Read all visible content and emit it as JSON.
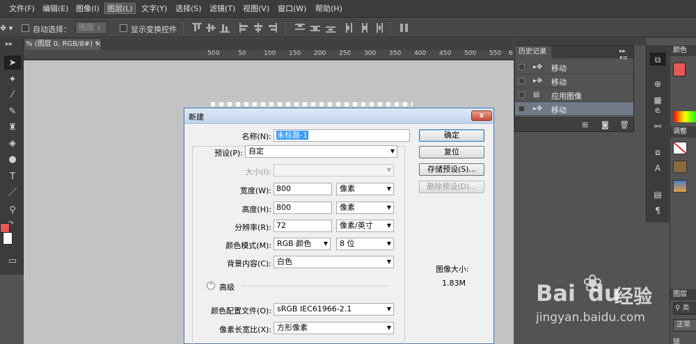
{
  "menubar": {
    "items": [
      "文件(F)",
      "编辑(E)",
      "图像(I)",
      "图层(L)",
      "文字(Y)",
      "选择(S)",
      "滤镜(T)",
      "视图(V)",
      "窗口(W)",
      "帮助(H)"
    ]
  },
  "optbar": {
    "auto_select_label": "自动选择：",
    "auto_select_value": "图层",
    "show_transform_label": "显示变换控件"
  },
  "document": {
    "tab_label": "% (图层 0, RGB/8#) *",
    "close": "×",
    "ruler_labels": [
      "50",
      "0",
      "50",
      "100",
      "150",
      "200",
      "250",
      "300",
      "350",
      "400",
      "450",
      "500",
      "550",
      "6"
    ]
  },
  "history": {
    "tab": "历史记录",
    "items": [
      {
        "label": "移动",
        "icon": "move-tool-icon"
      },
      {
        "label": "移动",
        "icon": "move-tool-icon"
      },
      {
        "label": "应用图像",
        "icon": "document-icon"
      },
      {
        "label": "移动",
        "icon": "move-tool-icon"
      }
    ]
  },
  "right_panels": {
    "color_tab": "颜色",
    "adjust_tab": "调整",
    "layers_tab": "图层",
    "kind_label": "类",
    "normal_label": "正常",
    "lock_label": "锁"
  },
  "dialog": {
    "title": "新建",
    "close": "x",
    "name_label": "名称(N):",
    "name_value": "未标题-1",
    "preset_label": "预设(P):",
    "preset_value": "自定",
    "size_label": "大小(I):",
    "width_label": "宽度(W):",
    "width_value": "800",
    "width_unit": "像素",
    "height_label": "高度(H):",
    "height_value": "800",
    "height_unit": "像素",
    "resolution_label": "分辨率(R):",
    "resolution_value": "72",
    "resolution_unit": "像素/英寸",
    "color_mode_label": "颜色模式(M):",
    "color_mode_value": "RGB 颜色",
    "bit_depth_value": "8 位",
    "background_label": "背景内容(C):",
    "background_value": "白色",
    "advanced_label": "高级",
    "color_profile_label": "颜色配置文件(O):",
    "color_profile_value": "sRGB IEC61966-2.1",
    "pixel_aspect_label": "像素长宽比(X):",
    "pixel_aspect_value": "方形像素",
    "ok_button": "确定",
    "reset_button": "复位",
    "save_preset_button": "存储预设(S)...",
    "delete_preset_button": "删除预设(D)...",
    "image_size_label": "图像大小:",
    "image_size_value": "1.83M"
  },
  "watermark": {
    "brand": "Bai",
    "brand2": "du",
    "product": "经验",
    "url": "jingyan.baidu.com"
  },
  "colors": {
    "foreground": "#e35a55",
    "background": "#ffffff",
    "accent": "#3399ff"
  }
}
